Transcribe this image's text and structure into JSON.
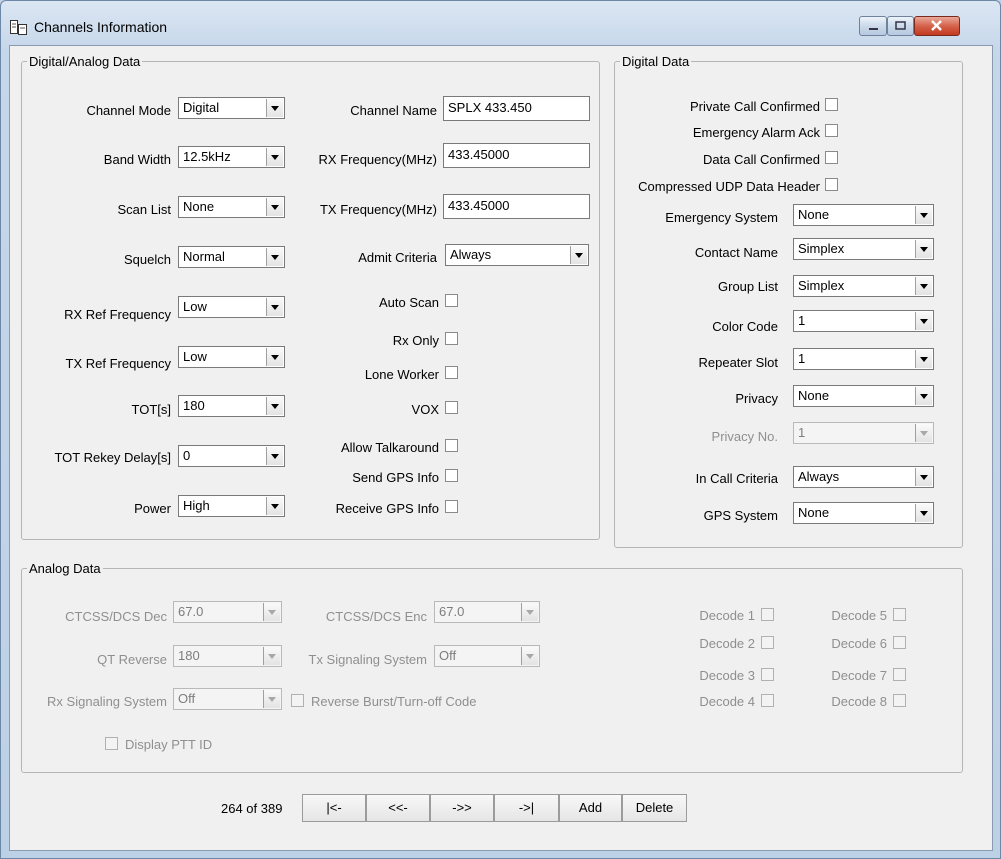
{
  "window": {
    "title": "Channels Information"
  },
  "groups": {
    "digital_analog": "Digital/Analog Data",
    "digital": "Digital Data",
    "analog": "Analog Data"
  },
  "left_fields": {
    "channel_mode": {
      "label": "Channel Mode",
      "value": "Digital"
    },
    "band_width": {
      "label": "Band Width",
      "value": "12.5kHz"
    },
    "scan_list": {
      "label": "Scan List",
      "value": "None"
    },
    "squelch": {
      "label": "Squelch",
      "value": "Normal"
    },
    "rx_ref_frequency": {
      "label": "RX Ref Frequency",
      "value": "Low"
    },
    "tx_ref_frequency": {
      "label": "TX Ref Frequency",
      "value": "Low"
    },
    "tot": {
      "label": "TOT[s]",
      "value": "180"
    },
    "tot_rekey_delay": {
      "label": "TOT Rekey Delay[s]",
      "value": "0"
    },
    "power": {
      "label": "Power",
      "value": "High"
    }
  },
  "mid_fields": {
    "channel_name": {
      "label": "Channel Name",
      "value": "SPLX 433.450"
    },
    "rx_frequency": {
      "label": "RX Frequency(MHz)",
      "value": "433.45000"
    },
    "tx_frequency": {
      "label": "TX Frequency(MHz)",
      "value": "433.45000"
    },
    "admit_criteria": {
      "label": "Admit Criteria",
      "value": "Always"
    }
  },
  "mid_checks": {
    "auto_scan": "Auto Scan",
    "rx_only": "Rx Only",
    "lone_worker": "Lone Worker",
    "vox": "VOX",
    "allow_talkaround": "Allow Talkaround",
    "send_gps_info": "Send GPS Info",
    "receive_gps_info": "Receive GPS Info"
  },
  "digital_checks": {
    "private_call_confirmed": "Private Call Confirmed",
    "emergency_alarm_ack": "Emergency Alarm Ack",
    "data_call_confirmed": "Data Call Confirmed",
    "compressed_udp": "Compressed UDP Data Header"
  },
  "digital_fields": {
    "emergency_system": {
      "label": "Emergency System",
      "value": "None"
    },
    "contact_name": {
      "label": "Contact Name",
      "value": "Simplex"
    },
    "group_list": {
      "label": "Group List",
      "value": "Simplex"
    },
    "color_code": {
      "label": "Color Code",
      "value": "1"
    },
    "repeater_slot": {
      "label": "Repeater Slot",
      "value": "1"
    },
    "privacy": {
      "label": "Privacy",
      "value": "None"
    },
    "privacy_no": {
      "label": "Privacy No.",
      "value": "1"
    },
    "in_call_criteria": {
      "label": "In Call Criteria",
      "value": "Always"
    },
    "gps_system": {
      "label": "GPS System",
      "value": "None"
    }
  },
  "analog_fields": {
    "ctcss_dec": {
      "label": "CTCSS/DCS Dec",
      "value": "67.0"
    },
    "ctcss_enc": {
      "label": "CTCSS/DCS Enc",
      "value": "67.0"
    },
    "qt_reverse": {
      "label": "QT Reverse",
      "value": "180"
    },
    "tx_signaling": {
      "label": "Tx Signaling System",
      "value": "Off"
    },
    "rx_signaling": {
      "label": "Rx Signaling System",
      "value": "Off"
    }
  },
  "analog_checks": {
    "reverse_burst": "Reverse Burst/Turn-off Code",
    "display_ptt_id": "Display PTT ID",
    "decode1": "Decode 1",
    "decode2": "Decode 2",
    "decode3": "Decode 3",
    "decode4": "Decode 4",
    "decode5": "Decode 5",
    "decode6": "Decode 6",
    "decode7": "Decode 7",
    "decode8": "Decode 8"
  },
  "nav": {
    "counter": "264 of 389",
    "first": "|<-",
    "prev": "<<-",
    "next": "->>",
    "last": "->|",
    "add": "Add",
    "delete": "Delete"
  }
}
